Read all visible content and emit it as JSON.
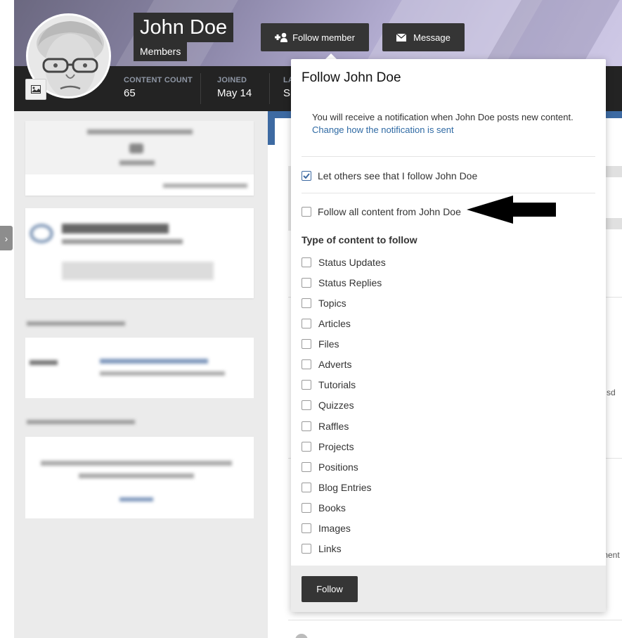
{
  "profile": {
    "name": "John Doe",
    "group": "Members",
    "follow_button": "Follow member",
    "message_button": "Message",
    "stats": [
      {
        "label": "CONTENT COUNT",
        "value": "65"
      },
      {
        "label": "JOINED",
        "value": "May 14"
      },
      {
        "label": "LA",
        "value": "S"
      }
    ]
  },
  "popup": {
    "title": "Follow John Doe",
    "description": "You will receive a notification when John Doe posts new content.",
    "change_link": "Change how the notification is sent",
    "show_follow_label": "Let others see that I follow John Doe",
    "show_follow_checked": true,
    "follow_all_label": "Follow all content from John Doe",
    "follow_all_checked": false,
    "section_title": "Type of content to follow",
    "content_types": [
      "Status Updates",
      "Status Replies",
      "Topics",
      "Articles",
      "Files",
      "Adverts",
      "Tutorials",
      "Quizzes",
      "Raffles",
      "Projects",
      "Positions",
      "Blog Entries",
      "Books",
      "Images",
      "Links"
    ],
    "submit_button": "Follow"
  },
  "partial_text": {
    "right_sd": "sd",
    "right_ment": "ment"
  },
  "colors": {
    "accent_blue": "#3d6aa2",
    "dark_button": "#353535",
    "stats_bar": "#232323",
    "link": "#2f6aa4"
  },
  "icons": {
    "follow": "user-plus-icon",
    "message": "envelope-icon",
    "cover_photo": "image-icon",
    "side_toggle": "chevron-right-icon",
    "annotation": "arrow-left-icon"
  }
}
